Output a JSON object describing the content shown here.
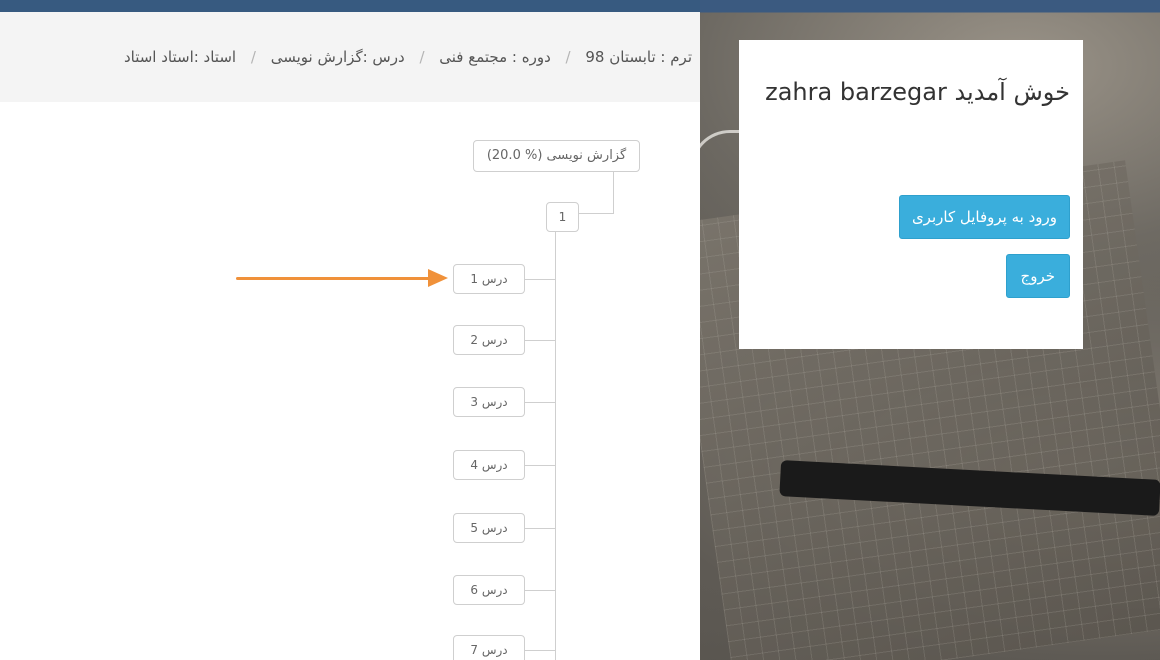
{
  "breadcrumb": {
    "term": "ترم : تابستان 98",
    "course": "دوره : مجتمع فنی",
    "lesson": "درس :گزارش نویسی",
    "teacher": "استاد :استاد استاد",
    "separator": "/"
  },
  "tree": {
    "root_label": "گزارش نویسی (% 20.0)",
    "term_node": "1",
    "lessons": [
      "درس 1",
      "درس 2",
      "درس 3",
      "درس 4",
      "درس 5",
      "درس 6",
      "درس 7"
    ]
  },
  "sidebar": {
    "welcome_text": "خوش آمدید zahra barzegar",
    "profile_button": "ورود به پروفایل کاربری",
    "logout_button": "خروج"
  },
  "colors": {
    "accent": "#3aaedc",
    "arrow": "#f0913a"
  }
}
